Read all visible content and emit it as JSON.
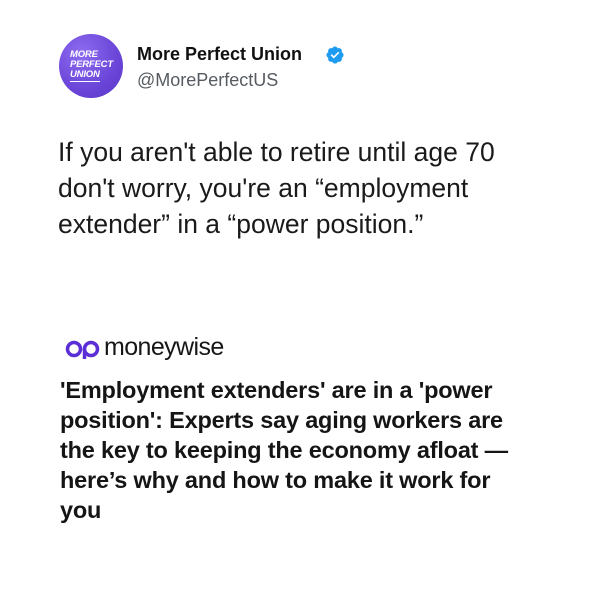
{
  "tweet": {
    "avatar_lines": [
      "MORE",
      "PERFECT",
      "UNION"
    ],
    "display_name": "More Perfect Union",
    "handle": "@MorePerfectUS",
    "verified": true,
    "text": "If you aren't able to retire until age 70 don't worry, you're an “employment extender” in a “power position.”"
  },
  "article": {
    "source": "moneywise",
    "headline": "'Employment extenders' are in a 'power position': Experts say aging workers are the key to keeping the economy afloat — here’s why and how to make it work for you"
  },
  "colors": {
    "avatar_purple": "#6a45d8",
    "verified_blue": "#1d9bf0",
    "moneywise_purple": "#5b2ed6",
    "handle_gray": "#555b61"
  }
}
